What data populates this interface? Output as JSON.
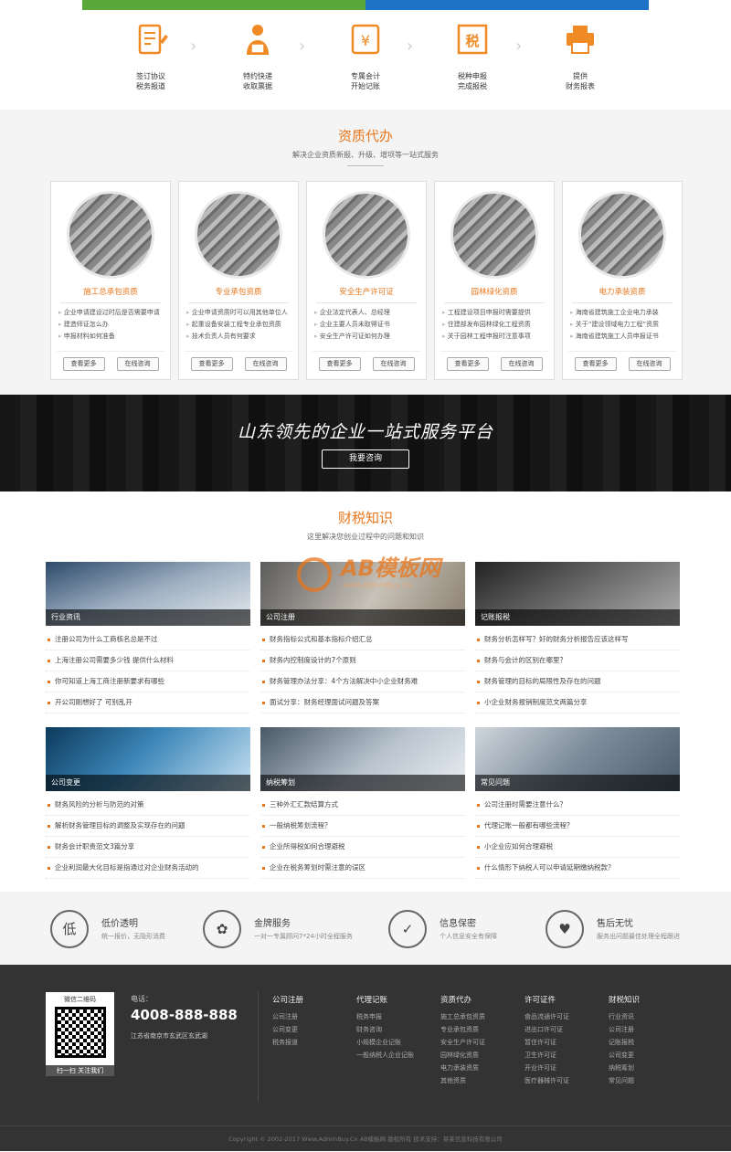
{
  "steps": [
    {
      "icon": "document-pen-icon",
      "line1": "签订协议",
      "line2": "税务报道"
    },
    {
      "icon": "courier-icon",
      "line1": "特约快递",
      "line2": "收取票据"
    },
    {
      "icon": "accounting-icon",
      "line1": "专属会计",
      "line2": "开始记账"
    },
    {
      "icon": "tax-icon",
      "line1": "税种申报",
      "line2": "完成报税"
    },
    {
      "icon": "printer-icon",
      "line1": "提供",
      "line2": "财务报表"
    }
  ],
  "qualification": {
    "title": "资质代办",
    "subtitle": "解决企业资质新报、升级、增项等一站式服务",
    "more_label": "查看更多",
    "consult_label": "在线咨询",
    "cards": [
      {
        "title": "施工总承包资质",
        "items": [
          "企业申请建设过时后是否需要申请",
          "建造师证怎么办",
          "申报材料如何准备"
        ]
      },
      {
        "title": "专业承包资质",
        "items": [
          "企业申请资质时可以用其他单位人",
          "起重设备安装工程专业承包资质",
          "技术负责人员有何要求"
        ]
      },
      {
        "title": "安全生产许可证",
        "items": [
          "企业法定代表人、总经理",
          "企业主要人员未取得证书",
          "安全生产许可证如何办理"
        ]
      },
      {
        "title": "园林绿化资质",
        "items": [
          "工程建设项目申报时需要提供",
          "住建部发布园林绿化工程资质",
          "关于园林工程申报时注意事项"
        ]
      },
      {
        "title": "电力承装资质",
        "items": [
          "海南省建筑施工企业电力承装",
          "关于“建设领域电力工程”资质",
          "海南省建筑施工人员申报证书"
        ]
      }
    ]
  },
  "banner": {
    "slogan": "山东领先的企业一站式服务平台",
    "cta": "我要咨询"
  },
  "knowledge": {
    "title": "财税知识",
    "subtitle": "这里解决您创业过程中的问题和知识",
    "columns": [
      {
        "label": "行业资讯",
        "items": [
          "注册公司为什么工商核名总是不过",
          "上海注册公司需要多少钱 提供什么材料",
          "你可知道上海工商注册新要求有哪些",
          "开公司刚想好了 可别乱开"
        ]
      },
      {
        "label": "公司注册",
        "items": [
          "财务指标公式和基本指标介绍汇总",
          "财务内控制度设计的7个原则",
          "财务管理办法分享：4个方法解决中小企业财务难",
          "面试分享：财务经理面试问题及答案"
        ]
      },
      {
        "label": "记账报税",
        "items": [
          "财务分析怎样写？好的财务分析报告应该这样写",
          "财务与会计的区别在哪里？",
          "财务管理的目标的局限性及存在的问题",
          "小企业财务报销制度范文两篇分享"
        ]
      },
      {
        "label": "公司变更",
        "items": [
          "财务风险的分析与防范的对策",
          "解析财务管理目标的调整及实现存在的问题",
          "财务会计职责范文3篇分享",
          "企业利润最大化目标是指通过对企业财务活动的"
        ]
      },
      {
        "label": "纳税筹划",
        "items": [
          "三种外汇汇款结算方式",
          "一般纳税筹划流程？",
          "企业所得税如何合理避税",
          "企业在税务筹划时需注意的误区"
        ]
      },
      {
        "label": "常见问题",
        "items": [
          "公司注册时需要注意什么？",
          "代理记账一般都有哪些流程？",
          "小企业应如何合理避税",
          "什么情形下纳税人可以申请延期缴纳税款？"
        ]
      }
    ]
  },
  "watermark": {
    "brand": "AB模板网",
    "url": "www.AdminBuy.Cn"
  },
  "features": [
    {
      "glyph": "低",
      "title": "低价透明",
      "desc": "统一报价，无隐形消费"
    },
    {
      "glyph": "✿",
      "title": "金牌服务",
      "desc": "一对一专属顾问7*24小时全程服务"
    },
    {
      "glyph": "✓",
      "title": "信息保密",
      "desc": "个人信息安全有保障"
    },
    {
      "glyph": "♥",
      "title": "售后无忧",
      "desc": "服务出问题最佳处理全程跟进"
    }
  ],
  "footer": {
    "qr_title": "微信二维码",
    "qr_caption": "扫一扫 关注我们",
    "phone_label": "电话：",
    "phone": "4008-888-888",
    "address": "江苏省南京市玄武区玄武湖",
    "columns": [
      {
        "title": "公司注册",
        "links": [
          "公司注册",
          "公司变更",
          "税务报道"
        ]
      },
      {
        "title": "代理记账",
        "links": [
          "税务申报",
          "财务咨询",
          "小规模企业记账",
          "一般纳税人企业记账"
        ]
      },
      {
        "title": "资质代办",
        "links": [
          "施工总承包资质",
          "专业承包资质",
          "安全生产许可证",
          "园林绿化资质",
          "电力承装资质",
          "其他资质"
        ]
      },
      {
        "title": "许可证件",
        "links": [
          "食品流通许可证",
          "进出口许可证",
          "暂住许可证",
          "卫生许可证",
          "开业许可证",
          "医疗器械许可证"
        ]
      },
      {
        "title": "财税知识",
        "links": [
          "行业资讯",
          "公司注册",
          "记账报税",
          "公司变更",
          "纳税筹划",
          "常见问题"
        ]
      }
    ],
    "copyright": "Copyright © 2002-2017 Www.AdminBuy.Cn AB模板网 版权所有 技术支持：某某信息科技有限公司"
  }
}
